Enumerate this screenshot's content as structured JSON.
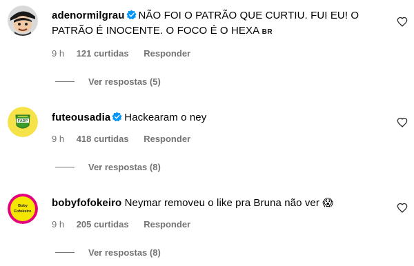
{
  "comments": [
    {
      "username": "adenormilgrau",
      "text": "NÃO FOI O PATRÃO QUE CURTIU. FUI EU! O PATRÃO É INOCENTE. O FOCO É O HEXA",
      "flag_code": "BR",
      "time": "9 h",
      "likes": "121 curtidas",
      "reply": "Responder",
      "view_replies": "Ver respostas (5)",
      "avatar_icon": "cartoon-face-avatar-icon"
    },
    {
      "username": "futeousadia",
      "text": "Hackearam o ney",
      "time": "9 h",
      "likes": "418 curtidas",
      "reply": "Responder",
      "view_replies": "Ver respostas (8)",
      "avatar_icon": "shield-logo-avatar-icon",
      "avatar_text": "FADP"
    },
    {
      "username": "bobyfofokeiro",
      "text": "Neymar removeu o like pra Bruna não ver",
      "emoji": "😱",
      "time": "9 h",
      "likes": "205 curtidas",
      "reply": "Responder",
      "view_replies": "Ver respostas (8)",
      "avatar_icon": "yellow-circle-logo-avatar-icon",
      "avatar_text": "Boby Fofokeiro"
    }
  ],
  "colors": {
    "verified": "#0095f6",
    "muted": "#737373",
    "green": "#3a9a2a",
    "yellow": "#f5e600",
    "pink": "#e4007d"
  }
}
